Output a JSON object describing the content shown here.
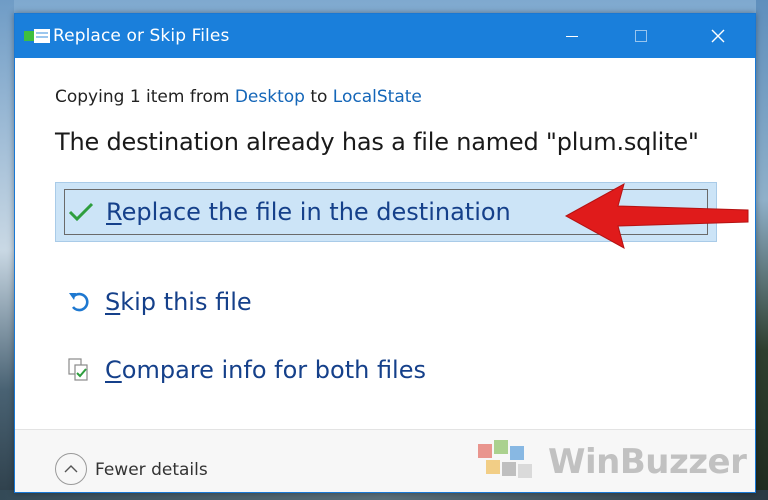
{
  "window": {
    "title": "Replace or Skip Files",
    "title_icon": "folder-copy-icon",
    "controls": {
      "minimize_icon": "minimize-icon",
      "maximize_icon": "maximize-icon",
      "close_icon": "close-icon"
    }
  },
  "copying": {
    "prefix": "Copying 1 item from ",
    "source": "Desktop",
    "middle": " to ",
    "destination": "LocalState"
  },
  "message": "The destination already has a file named \"plum.sqlite\"",
  "options": [
    {
      "hotkey": "R",
      "rest": "eplace the file in the destination",
      "icon": "checkmark-icon",
      "selected": true
    },
    {
      "hotkey": "S",
      "rest": "kip this file",
      "icon": "undo-arrow-icon",
      "selected": false
    },
    {
      "hotkey": "C",
      "rest": "ompare info for both files",
      "icon": "compare-files-icon",
      "selected": false
    }
  ],
  "footer": {
    "details_label": "Fewer details",
    "details_icon": "chevron-up-icon"
  },
  "watermark": {
    "text": "WinBuzzer"
  },
  "colors": {
    "titlebar": "#1a7fdb",
    "link": "#1466b8",
    "option_text": "#15408a",
    "selected_bg": "#cce4f7",
    "annotation_red": "#e01b1b"
  }
}
